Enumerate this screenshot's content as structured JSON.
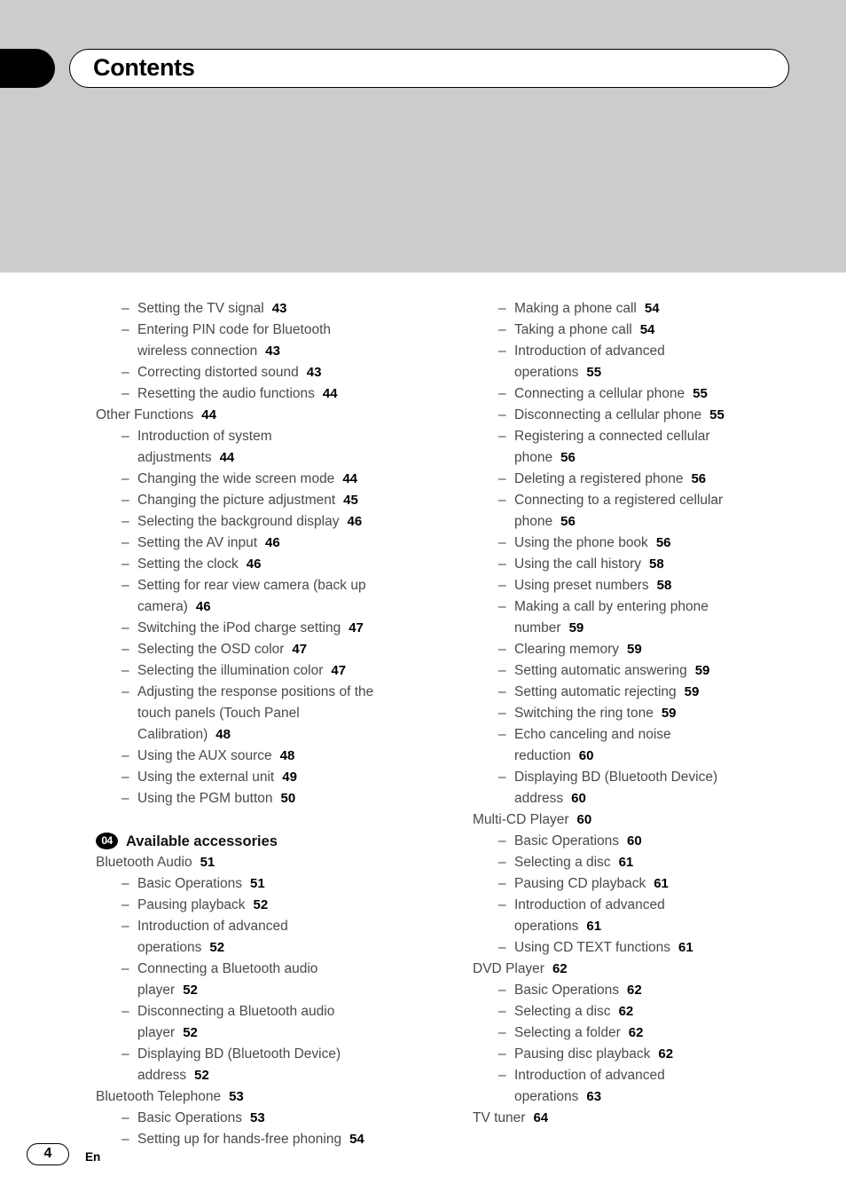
{
  "header": {
    "title": "Contents",
    "tab_icon": "black-tab-marker"
  },
  "footer": {
    "page_number": "4",
    "language": "En"
  },
  "columns": {
    "left": [
      {
        "kind": "entry",
        "level": 2,
        "label": "Setting the TV signal",
        "page": "43"
      },
      {
        "kind": "entry",
        "level": 2,
        "label": "Entering PIN code for Bluetooth",
        "page": ""
      },
      {
        "kind": "cont",
        "label": "wireless connection",
        "page": "43"
      },
      {
        "kind": "entry",
        "level": 2,
        "label": "Correcting distorted sound",
        "page": "43"
      },
      {
        "kind": "entry",
        "level": 2,
        "label": "Resetting the audio functions",
        "page": "44"
      },
      {
        "kind": "entry",
        "level": 1,
        "label": "Other Functions",
        "page": "44"
      },
      {
        "kind": "entry",
        "level": 2,
        "label": "Introduction of system",
        "page": ""
      },
      {
        "kind": "cont",
        "label": "adjustments",
        "page": "44"
      },
      {
        "kind": "entry",
        "level": 2,
        "label": "Changing the wide screen mode",
        "page": "44"
      },
      {
        "kind": "entry",
        "level": 2,
        "label": "Changing the picture adjustment",
        "page": "45"
      },
      {
        "kind": "entry",
        "level": 2,
        "label": "Selecting the background display",
        "page": "46"
      },
      {
        "kind": "entry",
        "level": 2,
        "label": "Setting the AV input",
        "page": "46"
      },
      {
        "kind": "entry",
        "level": 2,
        "label": "Setting the clock",
        "page": "46"
      },
      {
        "kind": "entry",
        "level": 2,
        "label": "Setting for rear view camera (back up",
        "page": ""
      },
      {
        "kind": "cont",
        "label": "camera)",
        "page": "46"
      },
      {
        "kind": "entry",
        "level": 2,
        "label": "Switching the iPod charge setting",
        "page": "47"
      },
      {
        "kind": "entry",
        "level": 2,
        "label": "Selecting the OSD color",
        "page": "47"
      },
      {
        "kind": "entry",
        "level": 2,
        "label": "Selecting the illumination color",
        "page": "47"
      },
      {
        "kind": "entry",
        "level": 2,
        "label": "Adjusting the response positions of the",
        "page": ""
      },
      {
        "kind": "cont",
        "label": "touch panels (Touch Panel",
        "page": ""
      },
      {
        "kind": "cont",
        "label": "Calibration)",
        "page": "48"
      },
      {
        "kind": "entry",
        "level": 2,
        "label": "Using the AUX source",
        "page": "48"
      },
      {
        "kind": "entry",
        "level": 2,
        "label": "Using the external unit",
        "page": "49"
      },
      {
        "kind": "entry",
        "level": 2,
        "label": "Using the PGM button",
        "page": "50"
      },
      {
        "kind": "chapter",
        "number": "04",
        "label": "Available accessories"
      },
      {
        "kind": "entry",
        "level": 1,
        "label": "Bluetooth Audio",
        "page": "51"
      },
      {
        "kind": "entry",
        "level": 2,
        "label": "Basic Operations",
        "page": "51"
      },
      {
        "kind": "entry",
        "level": 2,
        "label": "Pausing playback",
        "page": "52"
      },
      {
        "kind": "entry",
        "level": 2,
        "label": "Introduction of advanced",
        "page": ""
      },
      {
        "kind": "cont",
        "label": "operations",
        "page": "52"
      },
      {
        "kind": "entry",
        "level": 2,
        "label": "Connecting a Bluetooth audio",
        "page": ""
      },
      {
        "kind": "cont",
        "label": "player",
        "page": "52"
      },
      {
        "kind": "entry",
        "level": 2,
        "label": "Disconnecting a Bluetooth audio",
        "page": ""
      },
      {
        "kind": "cont",
        "label": "player",
        "page": "52"
      },
      {
        "kind": "entry",
        "level": 2,
        "label": "Displaying BD (Bluetooth Device)",
        "page": ""
      },
      {
        "kind": "cont",
        "label": "address",
        "page": "52"
      },
      {
        "kind": "entry",
        "level": 1,
        "label": "Bluetooth Telephone",
        "page": "53"
      },
      {
        "kind": "entry",
        "level": 2,
        "label": "Basic Operations",
        "page": "53"
      },
      {
        "kind": "entry",
        "level": 2,
        "label": "Setting up for hands-free phoning",
        "page": "54"
      }
    ],
    "right": [
      {
        "kind": "entry",
        "level": 2,
        "label": "Making a phone call",
        "page": "54"
      },
      {
        "kind": "entry",
        "level": 2,
        "label": "Taking a phone call",
        "page": "54"
      },
      {
        "kind": "entry",
        "level": 2,
        "label": "Introduction of advanced",
        "page": ""
      },
      {
        "kind": "cont",
        "label": "operations",
        "page": "55"
      },
      {
        "kind": "entry",
        "level": 2,
        "label": "Connecting a cellular phone",
        "page": "55"
      },
      {
        "kind": "entry",
        "level": 2,
        "label": "Disconnecting a cellular phone",
        "page": "55"
      },
      {
        "kind": "entry",
        "level": 2,
        "label": "Registering a connected cellular",
        "page": ""
      },
      {
        "kind": "cont",
        "label": "phone",
        "page": "56"
      },
      {
        "kind": "entry",
        "level": 2,
        "label": "Deleting a registered phone",
        "page": "56"
      },
      {
        "kind": "entry",
        "level": 2,
        "label": "Connecting to a registered cellular",
        "page": ""
      },
      {
        "kind": "cont",
        "label": "phone",
        "page": "56"
      },
      {
        "kind": "entry",
        "level": 2,
        "label": "Using the phone book",
        "page": "56"
      },
      {
        "kind": "entry",
        "level": 2,
        "label": "Using the call history",
        "page": "58"
      },
      {
        "kind": "entry",
        "level": 2,
        "label": "Using preset numbers",
        "page": "58"
      },
      {
        "kind": "entry",
        "level": 2,
        "label": "Making a call by entering phone",
        "page": ""
      },
      {
        "kind": "cont",
        "label": "number",
        "page": "59"
      },
      {
        "kind": "entry",
        "level": 2,
        "label": "Clearing memory",
        "page": "59"
      },
      {
        "kind": "entry",
        "level": 2,
        "label": "Setting automatic answering",
        "page": "59"
      },
      {
        "kind": "entry",
        "level": 2,
        "label": "Setting automatic rejecting",
        "page": "59"
      },
      {
        "kind": "entry",
        "level": 2,
        "label": "Switching the ring tone",
        "page": "59"
      },
      {
        "kind": "entry",
        "level": 2,
        "label": "Echo canceling and noise",
        "page": ""
      },
      {
        "kind": "cont",
        "label": "reduction",
        "page": "60"
      },
      {
        "kind": "entry",
        "level": 2,
        "label": "Displaying BD (Bluetooth Device)",
        "page": ""
      },
      {
        "kind": "cont",
        "label": "address",
        "page": "60"
      },
      {
        "kind": "entry",
        "level": 1,
        "label": "Multi-CD Player",
        "page": "60"
      },
      {
        "kind": "entry",
        "level": 2,
        "label": "Basic Operations",
        "page": "60"
      },
      {
        "kind": "entry",
        "level": 2,
        "label": "Selecting a disc",
        "page": "61"
      },
      {
        "kind": "entry",
        "level": 2,
        "label": "Pausing CD playback",
        "page": "61"
      },
      {
        "kind": "entry",
        "level": 2,
        "label": "Introduction of advanced",
        "page": ""
      },
      {
        "kind": "cont",
        "label": "operations",
        "page": "61"
      },
      {
        "kind": "entry",
        "level": 2,
        "label": "Using CD TEXT functions",
        "page": "61"
      },
      {
        "kind": "entry",
        "level": 1,
        "label": "DVD Player",
        "page": "62"
      },
      {
        "kind": "entry",
        "level": 2,
        "label": "Basic Operations",
        "page": "62"
      },
      {
        "kind": "entry",
        "level": 2,
        "label": "Selecting a disc",
        "page": "62"
      },
      {
        "kind": "entry",
        "level": 2,
        "label": "Selecting a folder",
        "page": "62"
      },
      {
        "kind": "entry",
        "level": 2,
        "label": "Pausing disc playback",
        "page": "62"
      },
      {
        "kind": "entry",
        "level": 2,
        "label": "Introduction of advanced",
        "page": ""
      },
      {
        "kind": "cont",
        "label": "operations",
        "page": "63"
      },
      {
        "kind": "entry",
        "level": 1,
        "label": "TV tuner",
        "page": "64"
      }
    ]
  },
  "symbols": {
    "dash": "–"
  }
}
